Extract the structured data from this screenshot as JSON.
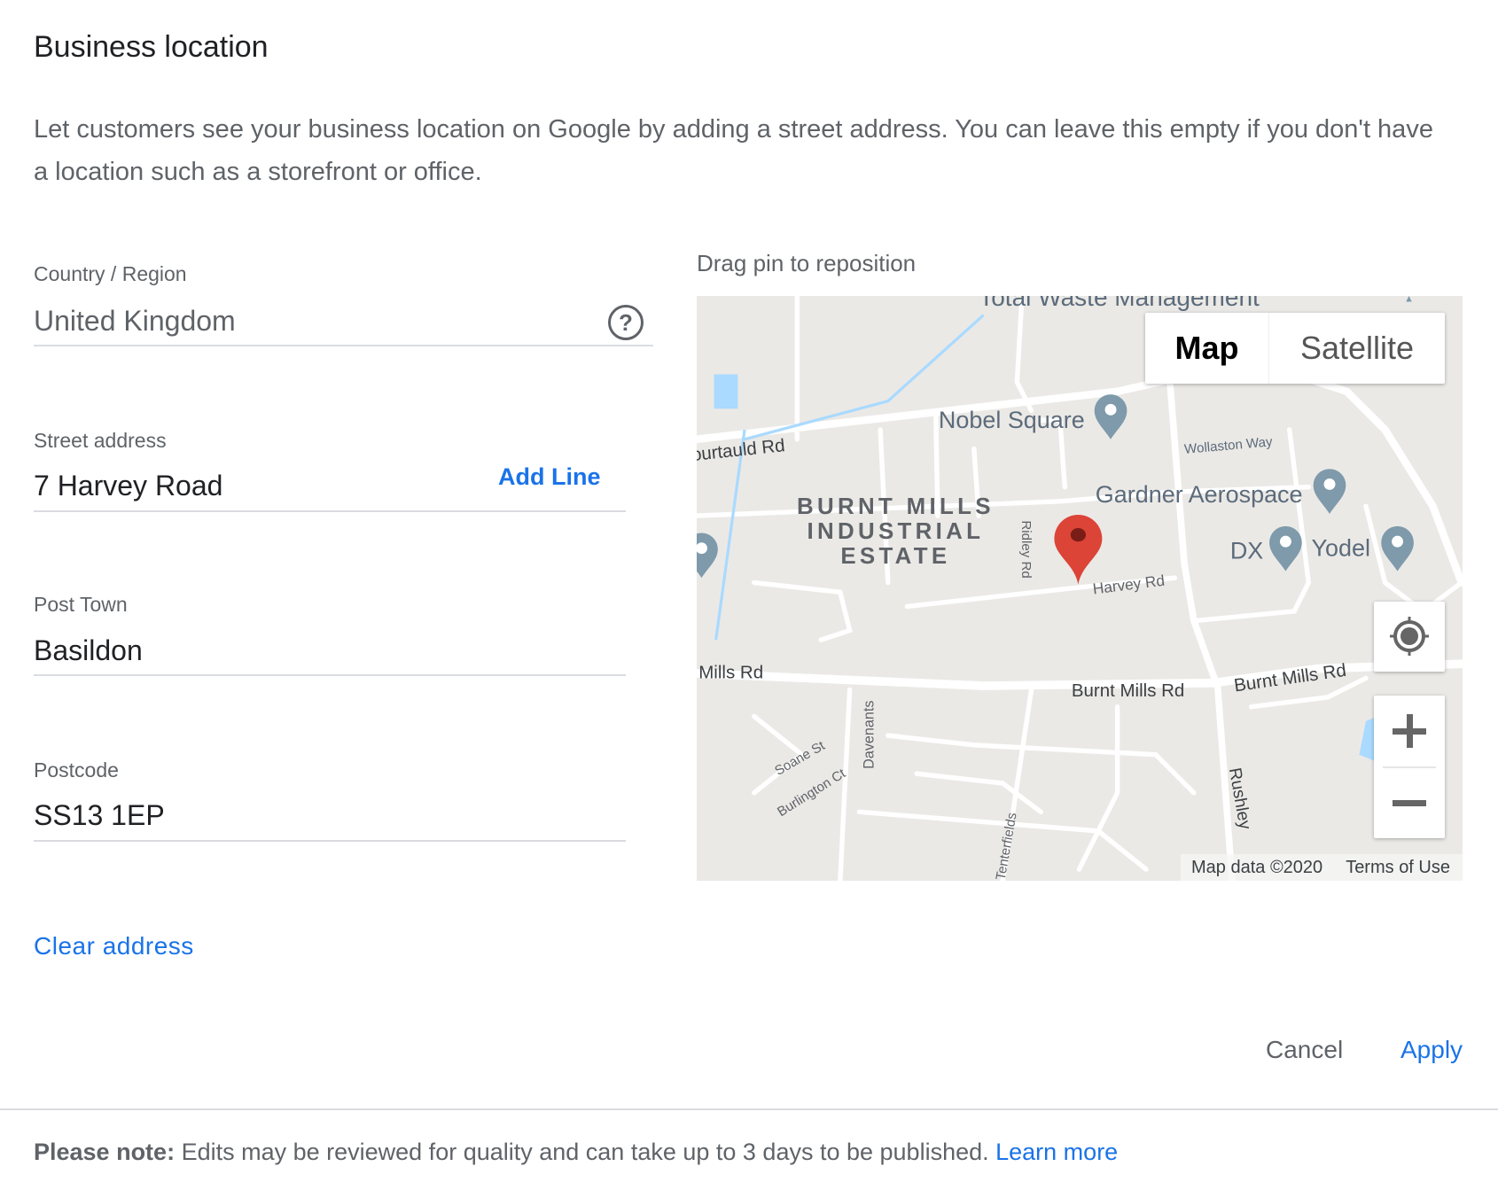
{
  "title": "Business location",
  "description": "Let customers see your business location on Google by adding a street address. You can leave this empty if you don't have a location such as a storefront or office.",
  "form": {
    "country_label": "Country / Region",
    "country_value": "United Kingdom",
    "street_label": "Street address",
    "street_value": "7 Harvey Road",
    "add_line": "Add Line",
    "town_label": "Post Town",
    "town_value": "Basildon",
    "postcode_label": "Postcode",
    "postcode_value": "SS13 1EP",
    "clear": "Clear address"
  },
  "map": {
    "hint": "Drag pin to reposition",
    "type_map": "Map",
    "type_satellite": "Satellite",
    "attribution": "Map data ©2020",
    "terms": "Terms of Use",
    "labels": {
      "total_waste": "Total Waste Management",
      "nobel": "Nobel Square",
      "courtauld": "Courtauld Rd",
      "wollaston": "Wollaston Way",
      "gardner": "Gardner Aerospace",
      "dx": "DX",
      "yodel": "Yodel",
      "estate1": "BURNT MILLS",
      "estate2": "INDUSTRIAL",
      "estate3": "ESTATE",
      "ridley": "Ridley Rd",
      "harvey": "Harvey Rd",
      "mills_left": "Mills Rd",
      "burnt1": "Burnt Mills Rd",
      "burnt2": "Burnt Mills Rd",
      "rushley": "Rushley",
      "davenants": "Davenants",
      "soane": "Soane St",
      "burlington": "Burlington Ct",
      "tenterfields": "Tenterfields"
    },
    "colors": {
      "background": "#ebe9e6",
      "road": "#ffffff",
      "poi_pin": "#7e9aab",
      "selected_pin": "#db4437",
      "water": "#aadaff"
    }
  },
  "actions": {
    "cancel": "Cancel",
    "apply": "Apply"
  },
  "note": {
    "bold": "Please note:",
    "text": " Edits may be reviewed for quality and can take up to 3 days to be published. ",
    "link": "Learn more"
  }
}
